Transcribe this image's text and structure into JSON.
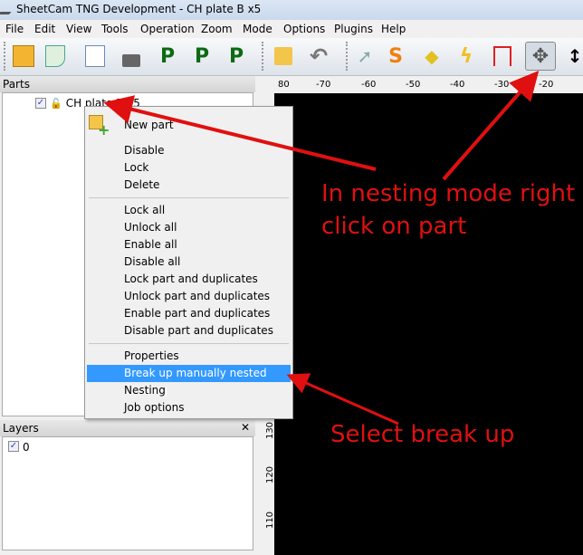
{
  "window": {
    "title": "SheetCam TNG Development - CH plate B x5"
  },
  "menubar": [
    "File",
    "Edit",
    "View",
    "Tools",
    "Operation",
    "Zoom",
    "Mode",
    "Options",
    "Plugins",
    "Help"
  ],
  "toolbar": {
    "icons": [
      "parts-save-icon",
      "run-post-icon",
      "edit-icon",
      "plug-icon",
      "post-p2-icon",
      "post-p3-icon",
      "post-p-plus-icon",
      "tool-check-icon",
      "undo-icon",
      "select-arrow-icon",
      "start-point-icon",
      "tag-icon",
      "lead-icon",
      "path-icon",
      "move-nest-icon",
      "measure-icon"
    ],
    "p_label": "P",
    "s_label": "S",
    "active": "move-nest-icon"
  },
  "parts": {
    "title": "Parts",
    "items": [
      {
        "label": "CH plate B x5",
        "checked": true,
        "locked": false
      }
    ]
  },
  "layers": {
    "title": "Layers",
    "close": "✕",
    "items": [
      {
        "label": "0",
        "checked": true
      }
    ]
  },
  "ruler": {
    "x": [
      "80",
      "-70",
      "-60",
      "-50",
      "-40",
      "-30",
      "-20"
    ],
    "y": [
      "130",
      "120",
      "110"
    ]
  },
  "context_menu": {
    "items": [
      "New part",
      "Disable",
      "Lock",
      "Delete",
      "Lock all",
      "Unlock all",
      "Enable all",
      "Disable all",
      "Lock part and duplicates",
      "Unlock part and duplicates",
      "Enable part and duplicates",
      "Disable part and duplicates",
      "Properties",
      "Break up manually nested drawing",
      "Nesting",
      "Job options"
    ],
    "highlighted": "Break up manually nested drawing"
  },
  "annotations": {
    "note1": "In nesting mode right click on part",
    "note2": "Select break up",
    "color": "#e01010"
  }
}
